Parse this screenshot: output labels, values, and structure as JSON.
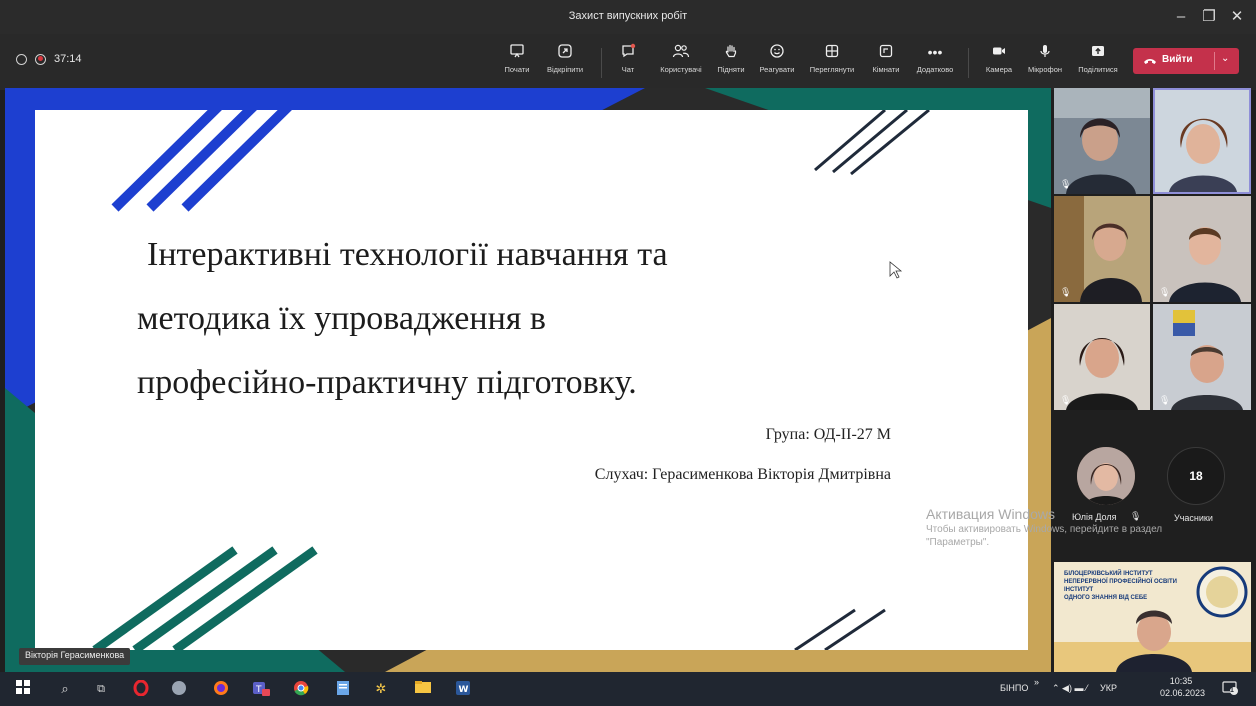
{
  "window": {
    "title": "Захист випускних робіт"
  },
  "recording": {
    "time": "37:14"
  },
  "toolbar": {
    "buttons": [
      {
        "label": "Почати",
        "icon": "whiteboard-icon"
      },
      {
        "label": "Відкріпити",
        "icon": "unpin-icon"
      },
      {
        "label": "Чат",
        "icon": "chat-icon"
      },
      {
        "label": "Користувачі",
        "icon": "people-icon"
      },
      {
        "label": "Підняти",
        "icon": "raise-hand-icon"
      },
      {
        "label": "Реагувати",
        "icon": "smile-icon"
      },
      {
        "label": "Переглянути",
        "icon": "view-grid-icon"
      },
      {
        "label": "Кімнати",
        "icon": "rooms-icon"
      },
      {
        "label": "Додатково",
        "icon": "more-icon"
      },
      {
        "label": "Камера",
        "icon": "camera-icon"
      },
      {
        "label": "Мікрофон",
        "icon": "mic-icon"
      },
      {
        "label": "Поділитися",
        "icon": "share-icon"
      }
    ],
    "leave_label": "Вийти"
  },
  "slide": {
    "line1": "Інтерактивні технології навчання та",
    "line2": "методика їх упровадження в",
    "line3": "професійно-практичну підготовку.",
    "group": "Група: ОД-ІІ-27 М",
    "student": "Слухач: Герасименкова Вікторія Дмитрівна"
  },
  "watermark": {
    "line1": "Активация Windows",
    "line2": "Чтобы активировать Windows, перейдите в раздел",
    "line3": "\"Параметры\"."
  },
  "presenter": {
    "name": "Вікторія Герасименкова"
  },
  "participants": {
    "featured_name": "Юлія Доля",
    "count": "18",
    "count_label": "Учасники"
  },
  "logo_text": {
    "line1": "БІЛОЦЕРКІВСЬКИЙ ІНСТИТУТ",
    "line2": "НЕПЕРЕРВНОЇ ПРОФЕСІЙНОЇ ОСВІТИ",
    "line3": "ІНСТИТУТ",
    "line4": "ОДНОГО ЗНАННЯ ВІД СЕБЕ"
  },
  "taskbar": {
    "input_lang": "БІНПО",
    "keyboard": "УКР",
    "time": "10:35",
    "date": "02.06.2023",
    "notifications": "1"
  },
  "colors": {
    "blue": "#1d3fd0",
    "teal": "#0f6b5f",
    "gold": "#c9a558",
    "leave": "#c4314b"
  }
}
